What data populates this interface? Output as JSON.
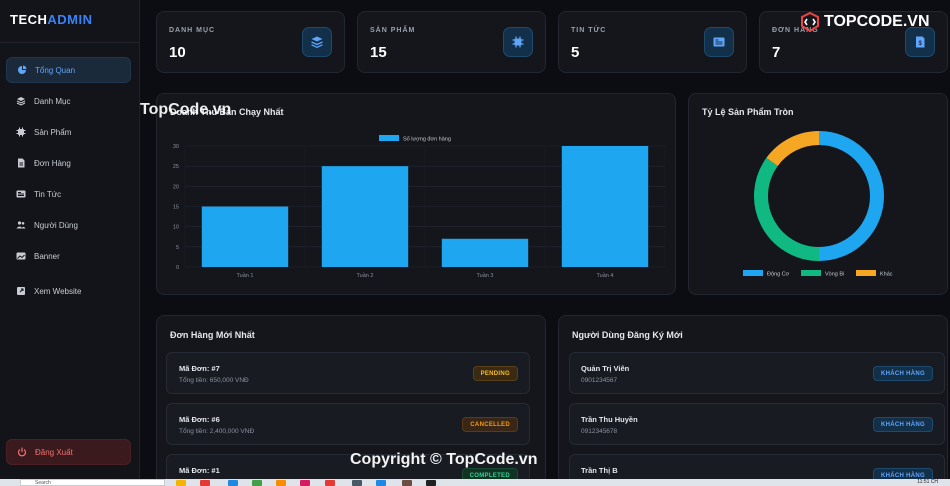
{
  "brand": {
    "part1": "TECH",
    "part2": "ADMIN"
  },
  "sidebar": {
    "items": [
      {
        "label": "Tổng Quan",
        "icon": "pie-chart-icon",
        "active": true
      },
      {
        "label": "Danh Mục",
        "icon": "layers-icon"
      },
      {
        "label": "Sản Phẩm",
        "icon": "chip-icon"
      },
      {
        "label": "Đơn Hàng",
        "icon": "document-icon"
      },
      {
        "label": "Tin Tức",
        "icon": "newspaper-icon"
      },
      {
        "label": "Người Dùng",
        "icon": "users-icon"
      },
      {
        "label": "Banner",
        "icon": "image-icon"
      },
      {
        "label": "Xem Website",
        "icon": "external-link-icon"
      }
    ],
    "logout": "Đăng Xuất"
  },
  "stats": [
    {
      "label": "DANH MỤC",
      "value": "10",
      "icon": "layers-icon"
    },
    {
      "label": "SẢN PHẨM",
      "value": "15",
      "icon": "chip-icon"
    },
    {
      "label": "TIN TỨC",
      "value": "5",
      "icon": "newspaper-icon"
    },
    {
      "label": "ĐƠN HÀNG",
      "value": "7",
      "icon": "receipt-icon"
    }
  ],
  "bar_panel": {
    "title": "Doanh Thu Bán Chạy Nhất"
  },
  "pie_panel": {
    "title": "Tỷ Lệ Sản Phẩm Tròn"
  },
  "chart_data": [
    {
      "type": "bar",
      "categories": [
        "Tuần 1",
        "Tuần 2",
        "Tuần 3",
        "Tuần 4"
      ],
      "series": [
        {
          "name": "Số lượng đơn hàng",
          "values": [
            15,
            25,
            7,
            30
          ],
          "color": "#1ea7f0"
        }
      ],
      "ylim": [
        0,
        30
      ],
      "yticks": [
        "0",
        "5",
        "10",
        "15",
        "20",
        "25",
        "30"
      ],
      "grid": true,
      "legend": "top"
    },
    {
      "type": "pie",
      "donut": true,
      "categories": [
        "Động Cơ",
        "Vòng Bi",
        "Khác"
      ],
      "values": [
        50,
        35,
        15
      ],
      "colors": [
        "#1ea7f0",
        "#10b981",
        "#f5a623"
      ],
      "legend": "bottom"
    }
  ],
  "orders": {
    "title": "Đơn Hàng Mới Nhất",
    "items": [
      {
        "code": "Mã Đơn: #7",
        "total": "Tổng tiền: 650,000 VNĐ",
        "status": "PENDING",
        "kind": "pending"
      },
      {
        "code": "Mã Đơn: #6",
        "total": "Tổng tiền: 2,400,000 VNĐ",
        "status": "CANCELLED",
        "kind": "cancelled"
      },
      {
        "code": "Mã Đơn: #1",
        "total": "",
        "status": "COMPLETED",
        "kind": "completed"
      }
    ]
  },
  "users": {
    "title": "Người Dùng Đăng Ký Mới",
    "items": [
      {
        "name": "Quản Trị Viên",
        "phone": "0901234567",
        "role": "KHÁCH HÀNG"
      },
      {
        "name": "Trần Thu Huyền",
        "phone": "0912345678",
        "role": "KHÁCH HÀNG"
      },
      {
        "name": "Trần Thị B",
        "phone": "",
        "role": "KHÁCH HÀNG"
      }
    ]
  },
  "watermark": {
    "top": "TopCode.vn",
    "logo": "TOPCODE.VN",
    "bottom": "Copyright © TopCode.vn"
  },
  "taskbar": {
    "search": "Search",
    "clock": "11:51 CH"
  }
}
